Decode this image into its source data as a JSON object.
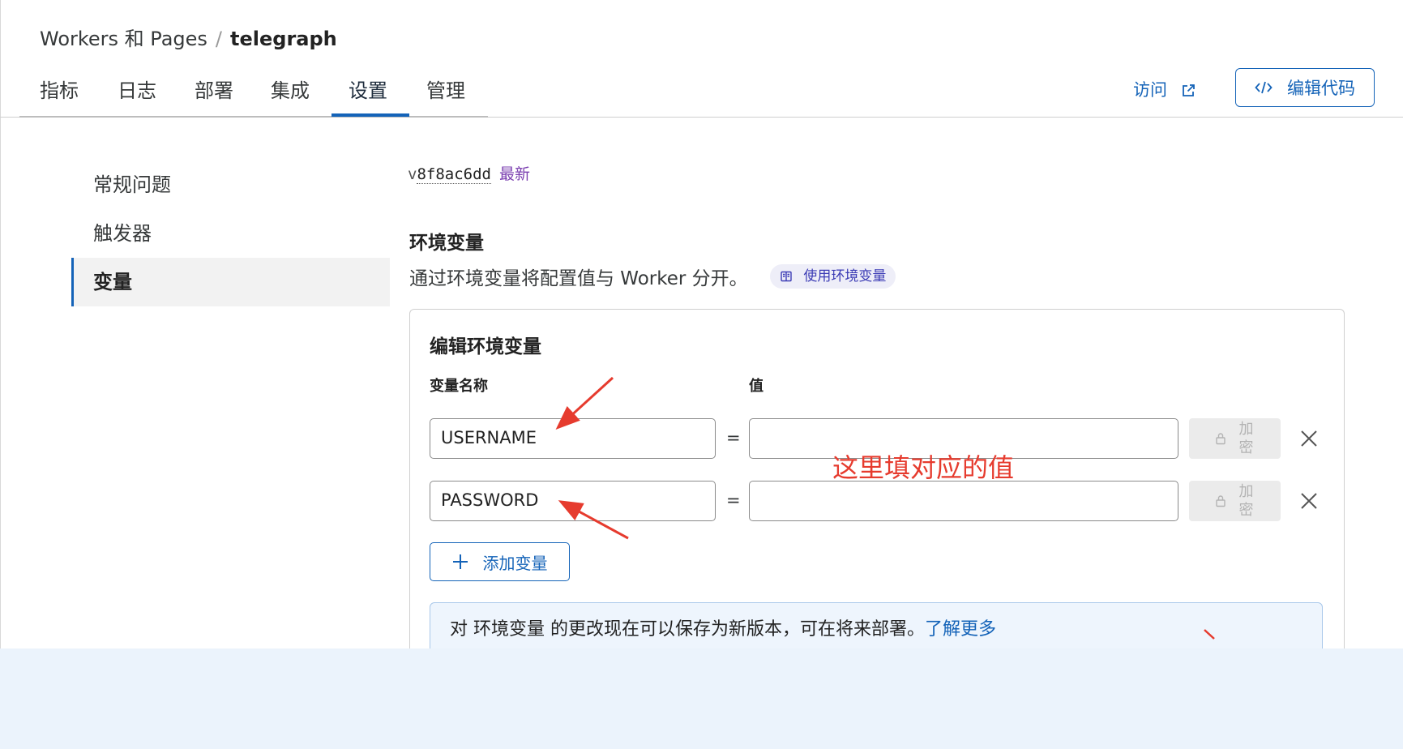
{
  "breadcrumb": {
    "parent": "Workers 和 Pages",
    "separator": "/",
    "current": "telegraph"
  },
  "tabs": [
    {
      "label": "指标"
    },
    {
      "label": "日志"
    },
    {
      "label": "部署"
    },
    {
      "label": "集成"
    },
    {
      "label": "设置",
      "active": true
    },
    {
      "label": "管理"
    }
  ],
  "header_actions": {
    "visit_label": "访问",
    "edit_code_label": "编辑代码"
  },
  "sidebar": {
    "items": [
      {
        "label": "常规问题"
      },
      {
        "label": "触发器"
      },
      {
        "label": "变量",
        "active": true
      }
    ]
  },
  "version": {
    "prefix": "v",
    "hash": "8f8ac6dd",
    "tag": "最新"
  },
  "env_section": {
    "title": "环境变量",
    "description": "通过环境变量将配置值与 Worker 分开。",
    "docs_badge": "使用环境变量"
  },
  "edit_card": {
    "title": "编辑环境变量",
    "name_column": "变量名称",
    "value_column": "值",
    "rows": [
      {
        "name": "USERNAME",
        "value": "",
        "equals": "=",
        "encrypt_label": "加密"
      },
      {
        "name": "PASSWORD",
        "value": "",
        "equals": "=",
        "encrypt_label": "加密"
      }
    ],
    "add_button": "添加变量",
    "banner": {
      "text": "对 环境变量 的更改现在可以保存为新版本，可在将来部署。",
      "link": "了解更多"
    }
  },
  "annotation": {
    "text": "这里填对应的值",
    "color": "#e63b2e"
  },
  "colors": {
    "accent": "#1463b8",
    "tag_purple": "#7b3fb0",
    "annotation_red": "#e63b2e"
  }
}
